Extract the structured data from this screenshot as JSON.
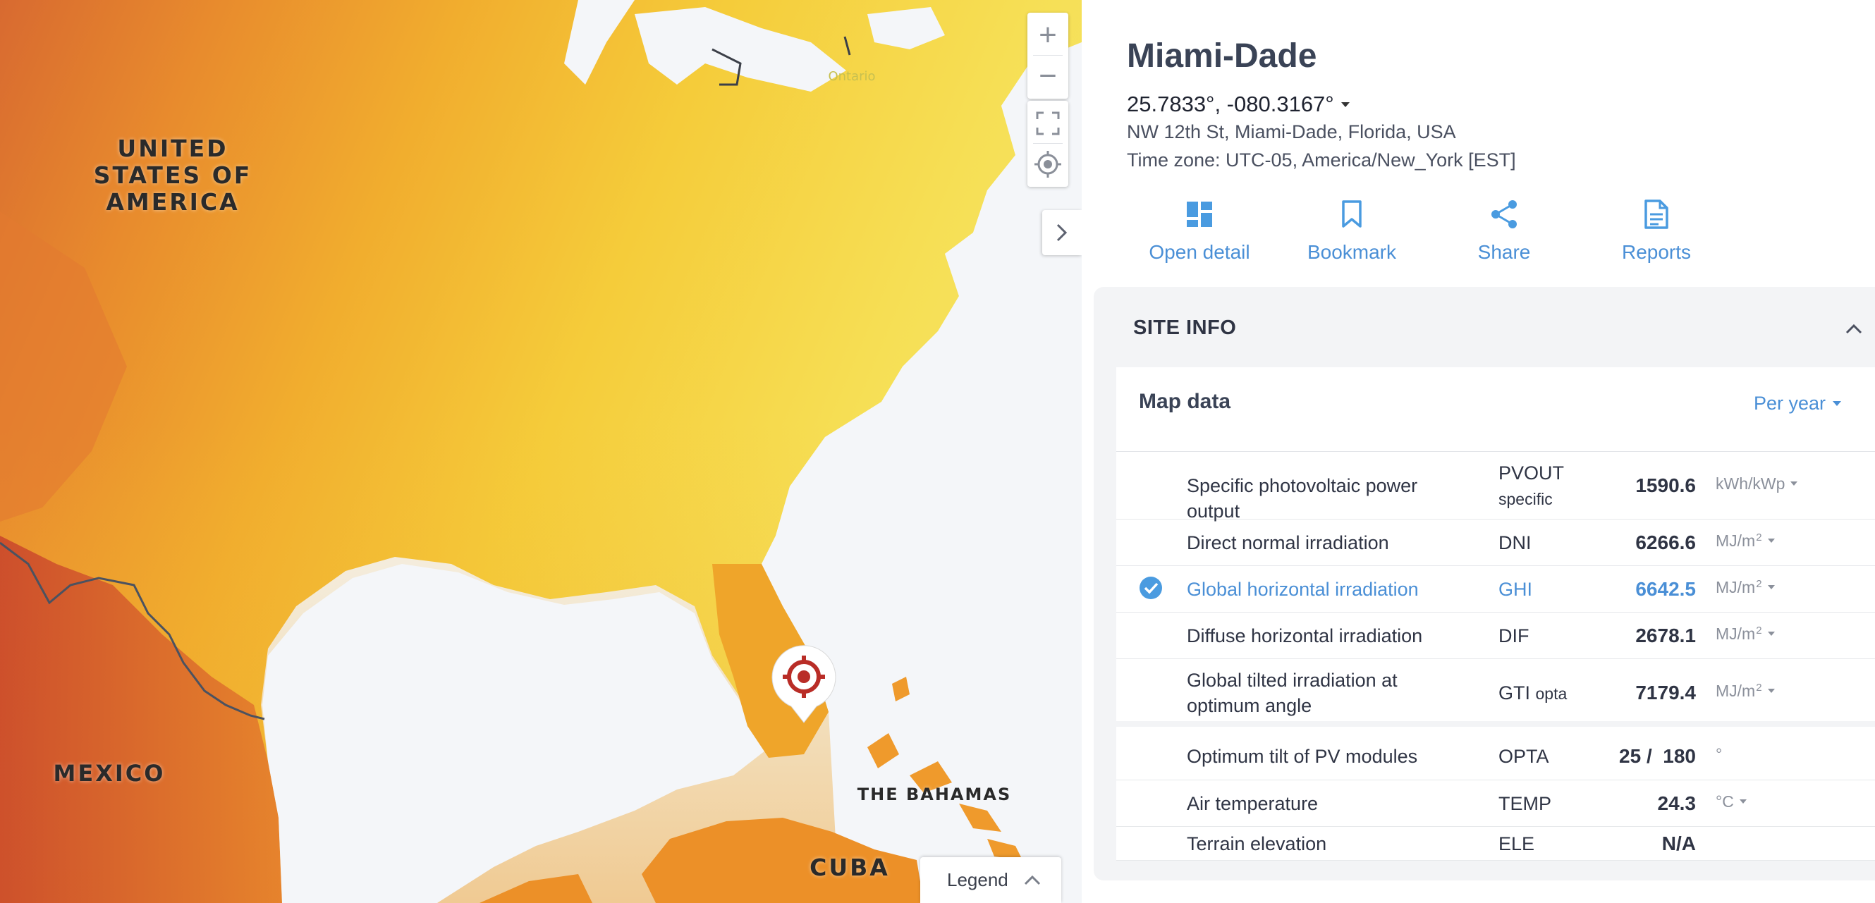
{
  "map": {
    "labels": {
      "usa": "UNITED STATES OF AMERICA",
      "mexico": "MEXICO",
      "bahamas": "THE BAHAMAS",
      "cuba": "CUBA",
      "city": "Ontario"
    },
    "controls": {
      "zoom_in": "+",
      "zoom_out": "−"
    },
    "legend_label": "Legend",
    "colors": {
      "high": "#d2582e",
      "mid": "#ec9a28",
      "low": "#f6e159",
      "water": "#f4f6f9",
      "marker": "#b92d27"
    }
  },
  "site": {
    "name": "Miami-Dade",
    "coordinates": "25.7833°, -080.3167°",
    "address": "NW 12th St, Miami-Dade, Florida, USA",
    "timezone": "Time zone: UTC-05, America/New_York [EST]"
  },
  "actions": {
    "open_detail": "Open detail",
    "bookmark": "Bookmark",
    "share": "Share",
    "reports": "Reports"
  },
  "site_info": {
    "title": "SITE INFO",
    "map_data_title": "Map data",
    "period": "Per year",
    "rows": [
      {
        "name": "Specific photovoltaic power output",
        "abbr": "PVOUT",
        "abbr_sub": "specific",
        "value": "1590.6",
        "unit": "kWh/kWp",
        "unit_sup": "",
        "selected": false
      },
      {
        "name": "Direct normal irradiation",
        "abbr": "DNI",
        "abbr_sub": "",
        "value": "6266.6",
        "unit": "MJ/m",
        "unit_sup": "2",
        "selected": false
      },
      {
        "name": "Global horizontal irradiation",
        "abbr": "GHI",
        "abbr_sub": "",
        "value": "6642.5",
        "unit": "MJ/m",
        "unit_sup": "2",
        "selected": true
      },
      {
        "name": "Diffuse horizontal irradiation",
        "abbr": "DIF",
        "abbr_sub": "",
        "value": "2678.1",
        "unit": "MJ/m",
        "unit_sup": "2",
        "selected": false
      },
      {
        "name": "Global tilted irradiation at optimum angle",
        "abbr": "GTI",
        "abbr_sub": "opta",
        "value": "7179.4",
        "unit": "MJ/m",
        "unit_sup": "2",
        "selected": false
      },
      {
        "name": "Optimum tilt of PV modules",
        "abbr": "OPTA",
        "abbr_sub": "",
        "value": "25 /  180",
        "unit": "°",
        "unit_sup": "",
        "selected": false
      },
      {
        "name": "Air temperature",
        "abbr": "TEMP",
        "abbr_sub": "",
        "value": "24.3",
        "unit": "°C",
        "unit_sup": "",
        "selected": false
      },
      {
        "name": "Terrain elevation",
        "abbr": "ELE",
        "abbr_sub": "",
        "value": "N/A",
        "unit": "",
        "unit_sup": "",
        "selected": false
      }
    ]
  }
}
